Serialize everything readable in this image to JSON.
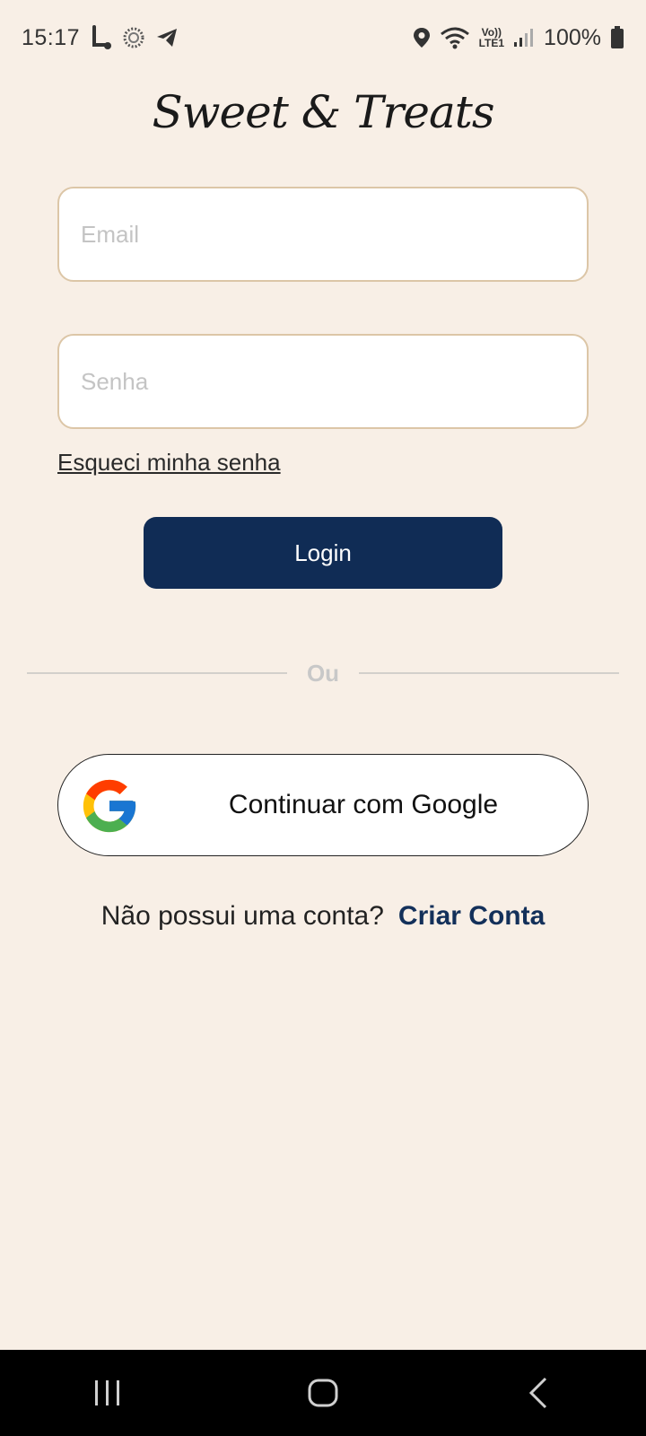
{
  "status_bar": {
    "time": "15:17",
    "battery": "100%",
    "network_label_top": "Vo))",
    "network_label_bottom": "LTE1",
    "icons": [
      "l-app-icon",
      "sun-icon",
      "telegram-icon",
      "location-icon",
      "wifi-icon",
      "signal-icon",
      "battery-icon"
    ]
  },
  "logo": {
    "text": "Sweet & Treats"
  },
  "login_form": {
    "email_placeholder": "Email",
    "email_value": "",
    "password_placeholder": "Senha",
    "password_value": "",
    "forgot_password": "Esqueci minha senha",
    "login_label": "Login"
  },
  "divider": {
    "text": "Ou"
  },
  "google": {
    "label": "Continuar com Google"
  },
  "signup": {
    "prompt": "Não possui uma conta?",
    "link": "Criar Conta"
  },
  "nav_bar": {
    "buttons": [
      "recent-apps-icon",
      "home-icon",
      "back-icon"
    ]
  },
  "colors": {
    "background": "#f8efe6",
    "primary": "#102c55",
    "input_border": "#dcc6a7",
    "link": "#13305a"
  }
}
